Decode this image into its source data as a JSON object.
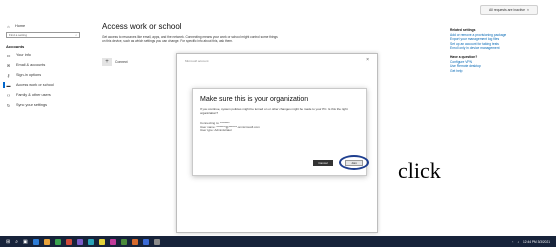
{
  "notification": {
    "label": "All requests are inactive",
    "close_glyph": "×"
  },
  "nav": {
    "home_label": "Home",
    "search_placeholder": "Find a setting",
    "section_title": "Accounts",
    "items": [
      {
        "label": "Your info",
        "icon": "person-card-icon"
      },
      {
        "label": "Email & accounts",
        "icon": "mail-icon"
      },
      {
        "label": "Sign-in options",
        "icon": "key-icon"
      },
      {
        "label": "Access work or school",
        "icon": "briefcase-icon"
      },
      {
        "label": "Family & other users",
        "icon": "people-icon"
      },
      {
        "label": "Sync your settings",
        "icon": "sync-icon"
      }
    ]
  },
  "main": {
    "title": "Access work or school",
    "description": "Get access to resources like email, apps, and the network. Connecting means your work or school might control some things on this device, such as which settings you can change. For specific info about this, ask them.",
    "connect_label": "Connect"
  },
  "right": {
    "related_title": "Related settings",
    "related_links": [
      "Add or remove a provisioning package",
      "Export your management log files",
      "Set up an account for taking tests",
      "Enroll only in device management"
    ],
    "question_title": "Have a question?",
    "help_links": [
      "Configure VPN",
      "Use Remote desktop",
      "Get help"
    ]
  },
  "dialog": {
    "header": "Microsoft account",
    "close_glyph": "×",
    "inner_title": "Make sure this is your organization",
    "inner_body": "If you continue, system policies might be turned on or other changes might be made to your PC. Is this the right organization?",
    "info_lines": [
      "Connecting to: ********",
      "User name: ********@*******.onmicrosoft.com",
      "User type: Administrator"
    ],
    "cancel_label": "Cancel",
    "join_label": "Join"
  },
  "annotation": {
    "text": "click"
  },
  "taskbar": {
    "start_glyph": "⊞",
    "app_colors": [
      "#2d7cd6",
      "#e8a23a",
      "#3aa34f",
      "#d04a3a",
      "#7a5bc8",
      "#2aa3b8",
      "#e3d33a",
      "#c13b9a",
      "#4a8a3a",
      "#d66a2d",
      "#3a6ad6",
      "#8a8a8a"
    ],
    "time": "12:44 PM",
    "date": "3/3/2021"
  }
}
